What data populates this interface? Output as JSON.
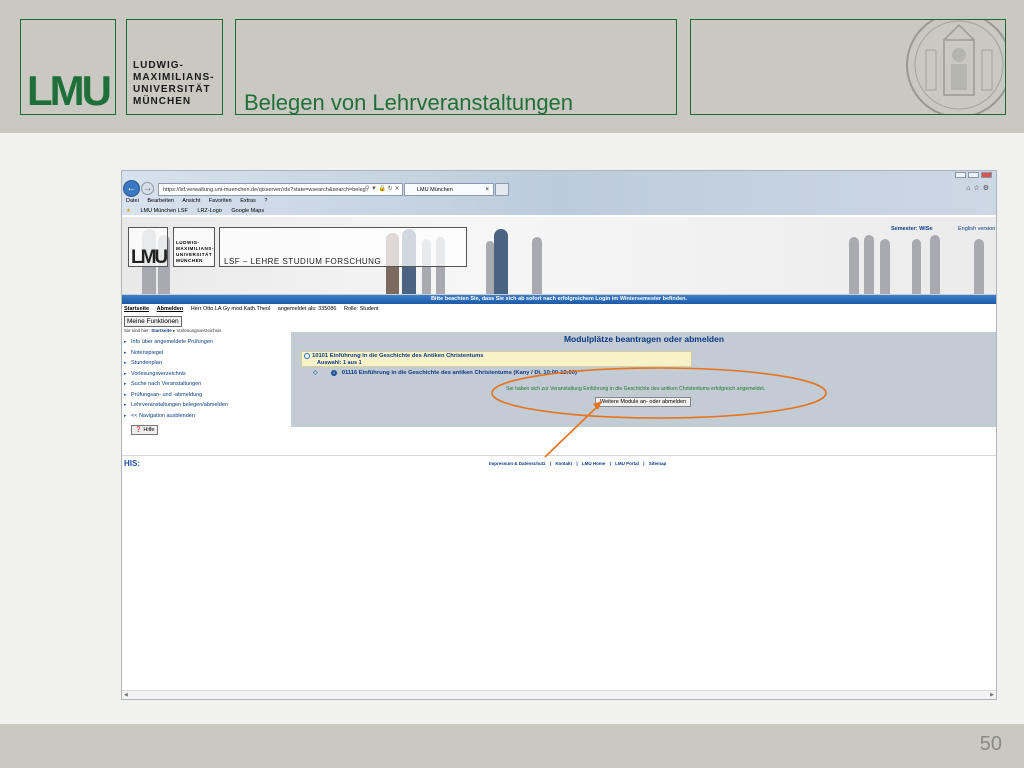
{
  "slide": {
    "logo_text": "LMU",
    "uni_lines": [
      "LUDWIG-",
      "MAXIMILIANS-",
      "UNIVERSITÄT",
      "MÜNCHEN"
    ],
    "title": "Belegen von Lehrveranstaltungen",
    "page_number": "50"
  },
  "browser": {
    "url": "https://lsf.verwaltung.uni-muenchen.de/qisserver/rds?state=wsearch&search=beleg",
    "tab_title": "LMU München",
    "menu": [
      "Datei",
      "Bearbeiten",
      "Ansicht",
      "Favoriten",
      "Extras",
      "?"
    ],
    "favorites": [
      "LMU München LSF",
      "LRZ-Logo",
      "Google Maps"
    ]
  },
  "lsf": {
    "logo_text": "LMU",
    "uni_lines": [
      "LUDWIG-",
      "MAXIMILIANS-",
      "UNIVERSITÄT",
      "MÜNCHEN"
    ],
    "title": "LSF – LEHRE STUDIUM FORSCHUNG",
    "semester_label": "Semester: WiSe",
    "english_link": "English version",
    "notice": "Bitte beachten Sie, dass Sie sich ab sofort nach erfolgreichem Login im Wintersemester            befinden.",
    "info": {
      "startseite": "Startseite",
      "abmelden": "Abmelden",
      "user": "Herr Otto LA Gy mod.Kath.Theol",
      "logged_in": "angemeldet als: 335086",
      "role": "Rolle: Student"
    },
    "meine_funktionen": "Meine Funktionen",
    "crumb_prefix": "Sie sind hier:",
    "crumb_home": "Startseite",
    "crumb_current": "Vorlesungsverzeichnis",
    "side_nav": [
      "Info über angemeldete Prüfungen",
      "Notenspiegel",
      "Stundenplan",
      "Vorlesungsverzeichnis",
      "Suche nach Veranstaltungen",
      "Prüfungsan- und -abmeldung",
      "Lehrveranstaltungen belegen/abmelden",
      "<< Navigation ausblenden"
    ],
    "hilfe": "Hilfe",
    "panel": {
      "title": "Modulplätze beantragen oder abmelden",
      "module": "10101 Einführung in die Geschichte des Antiken Christentums",
      "selection": "Auswahl: 1 aus 1",
      "course": "01116 Einführung in die Geschichte des antiken Christentums (Kany / Di. 10:00-12:00)",
      "success": "Sie haben sich zur Veranstaltung Einführung in die Geschichte des antiken Christentums erfolgreich angemeldet.",
      "button": "Weitere Module an- oder abmelden"
    },
    "his": "HIS:",
    "footer_links": [
      "Impressum & Datenschutz",
      "|",
      "Kontakt",
      "|",
      "LMU Home",
      "|",
      "LMU Portal",
      "|",
      "Sitemap"
    ]
  },
  "colors": {
    "lmu_green": "#1f6f3a",
    "annotation": "#e8731e",
    "notice_blue": "#1d5aa6"
  }
}
